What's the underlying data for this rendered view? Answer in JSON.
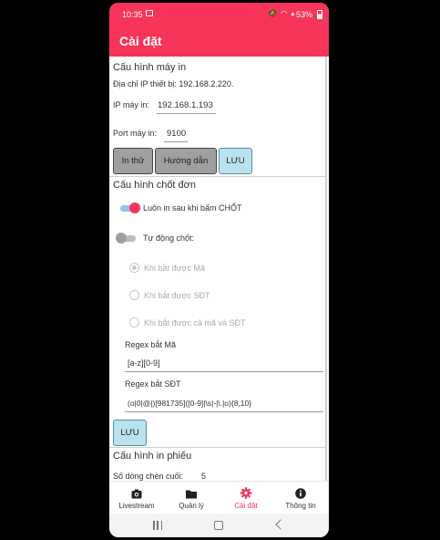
{
  "status_bar": {
    "time": "10:35",
    "battery": "53%",
    "icons": [
      "image-notification-icon",
      "mute-icon",
      "wifi-icon",
      "signal-icon",
      "battery-icon"
    ]
  },
  "app_bar": {
    "title": "Cài đặt"
  },
  "printer_config": {
    "title": "Cấu hình máy in",
    "device_ip": "Địa chỉ IP thiết bị: 192.168.2.220.",
    "ip_label": "IP máy in:",
    "ip_value": "192.168.1.193",
    "port_label": "Port máy in:",
    "port_value": "9100",
    "buttons": {
      "test": "In thử",
      "guide": "Hướng dẫn",
      "save": "LƯU"
    }
  },
  "order_config": {
    "title": "Cấu hình chốt đơn",
    "always_print": {
      "label": "Luôn in sau khi bấm CHỐT",
      "on": true
    },
    "auto_close": {
      "label": "Tự động chốt:",
      "on": false
    },
    "radio_options": [
      {
        "label": "Khi bắt được Mã",
        "checked": true
      },
      {
        "label": "Khi bắt được SĐT",
        "checked": false
      },
      {
        "label": "Khi bắt được cả mã và SĐT",
        "checked": false
      }
    ],
    "regex_code_label": "Regex bắt Mã",
    "regex_code_value": "[a-z][0-9]",
    "regex_phone_label": "Regex bắt SĐT",
    "regex_phone_value": "(o|0|@|)[981735]([0-9]|\\s|-|\\.|o){8,10}",
    "save": "LƯU"
  },
  "slip_config": {
    "title": "Cấu hình in phiếu",
    "blank_lines_label": "Số dòng chèn cuối:",
    "blank_lines_value": "5"
  },
  "bottom_nav": [
    {
      "label": "Livestream",
      "icon": "camera-icon",
      "active": false
    },
    {
      "label": "Quản lý",
      "icon": "folder-icon",
      "active": false
    },
    {
      "label": "Cài đặt",
      "icon": "gear-icon",
      "active": true
    },
    {
      "label": "Thông tin",
      "icon": "info-icon",
      "active": false
    }
  ],
  "colors": {
    "accent": "#f7345a",
    "save_button": "#b9e2ef",
    "gray_button": "#9f9f9f"
  }
}
